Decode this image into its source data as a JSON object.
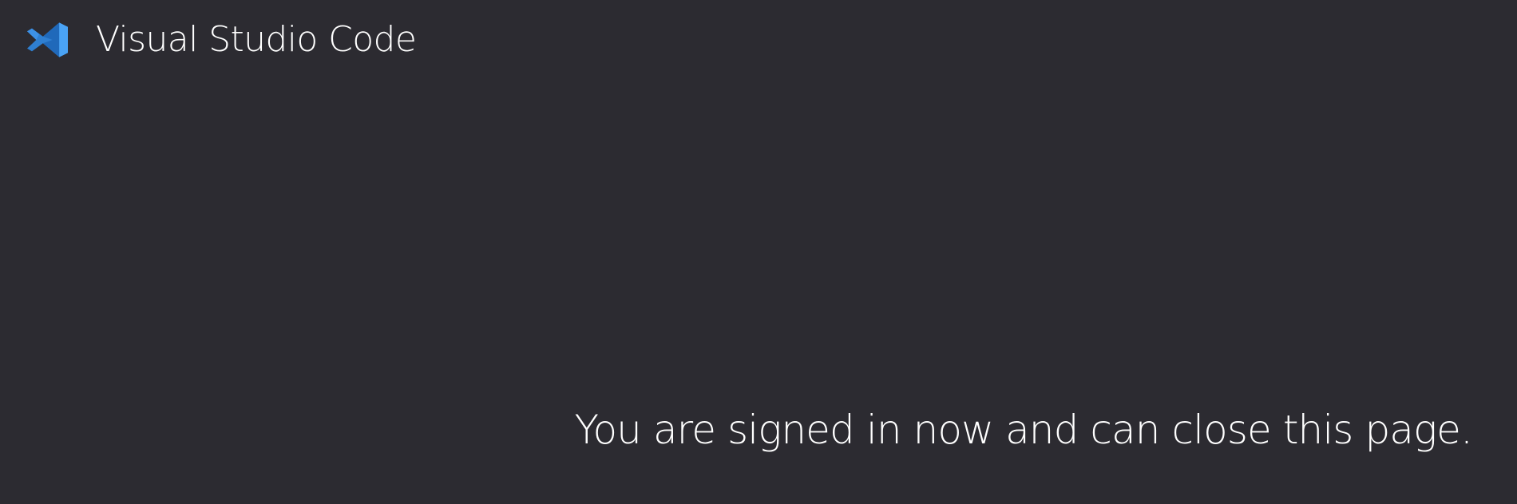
{
  "header": {
    "logo_icon": "visual-studio-code-logo-icon",
    "title": "Visual Studio Code"
  },
  "main": {
    "message": "You are signed in now and can close this page."
  },
  "colors": {
    "background": "#2c2b31",
    "text": "#ffffff",
    "brand_blue": "#2f7fd1"
  }
}
